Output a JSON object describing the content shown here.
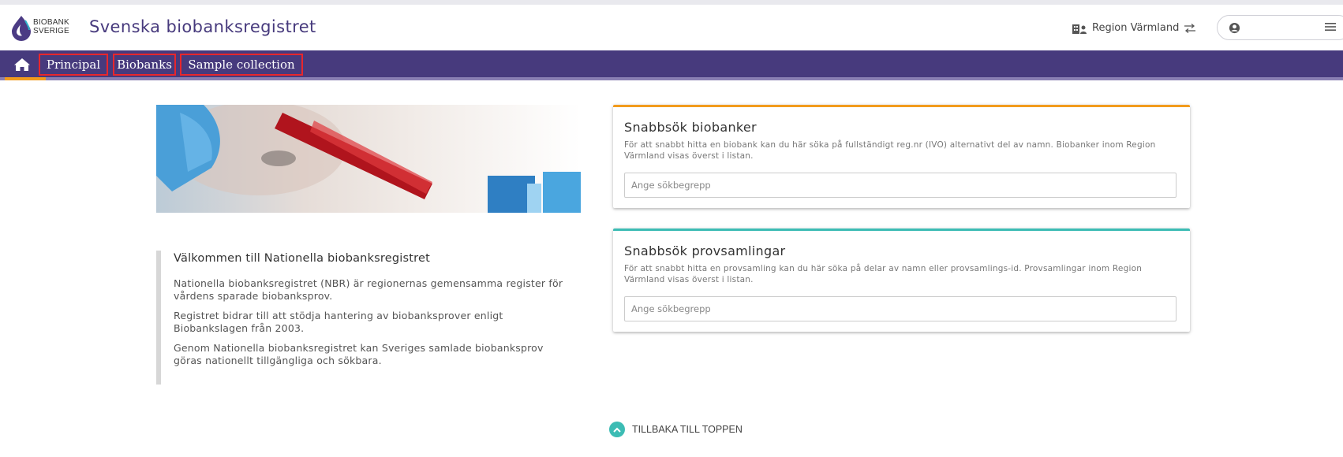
{
  "header": {
    "logo_line1": "BIOBANK",
    "logo_line2": "SVERIGE",
    "app_title": "Svenska biobanksregistret",
    "region_label": "Region Värmland",
    "region_icon": "building-icon",
    "switch_icon": "swap-arrows-icon",
    "user_icon": "user-circle-icon",
    "menu_icon": "hamburger-icon"
  },
  "nav": {
    "home_icon": "home-icon",
    "items": [
      {
        "label": "Principal"
      },
      {
        "label": "Biobanks"
      },
      {
        "label": "Sample collection"
      }
    ]
  },
  "welcome": {
    "title": "Välkommen till Nationella biobanksregistret",
    "paragraphs": [
      "Nationella biobanksregistret (NBR) är regionernas gemensamma register för vårdens sparade biobanksprov.",
      "Registret bidrar till att stödja hantering av biobanksprover enligt Biobankslagen från 2003.",
      "Genom Nationella biobanksregistret kan Sveriges samlade biobanksprov göras nationellt tillgängliga och sökbara."
    ]
  },
  "search_biobanks": {
    "title": "Snabbsök biobanker",
    "description": "För att snabbt hitta en biobank kan du här söka på fullständigt reg.nr (IVO) alternativt del av namn. Biobanker inom Region Värmland visas överst i listan.",
    "placeholder": "Ange sökbegrepp"
  },
  "search_collections": {
    "title": "Snabbsök provsamlingar",
    "description": "För att snabbt hitta en provsamling kan du här söka på delar av namn eller provsamlings-id. Provsamlingar inom Region Värmland visas överst i listan.",
    "placeholder": "Ange sökbegrepp"
  },
  "footer": {
    "back_to_top": "TILLBAKA TILL TOPPEN",
    "back_to_top_icon": "chevron-up-circle-icon"
  },
  "colors": {
    "primary_purple": "#473a7d",
    "accent_orange": "#f29b1d",
    "accent_teal": "#3cbcb4",
    "highlight_red": "#e8262c"
  }
}
